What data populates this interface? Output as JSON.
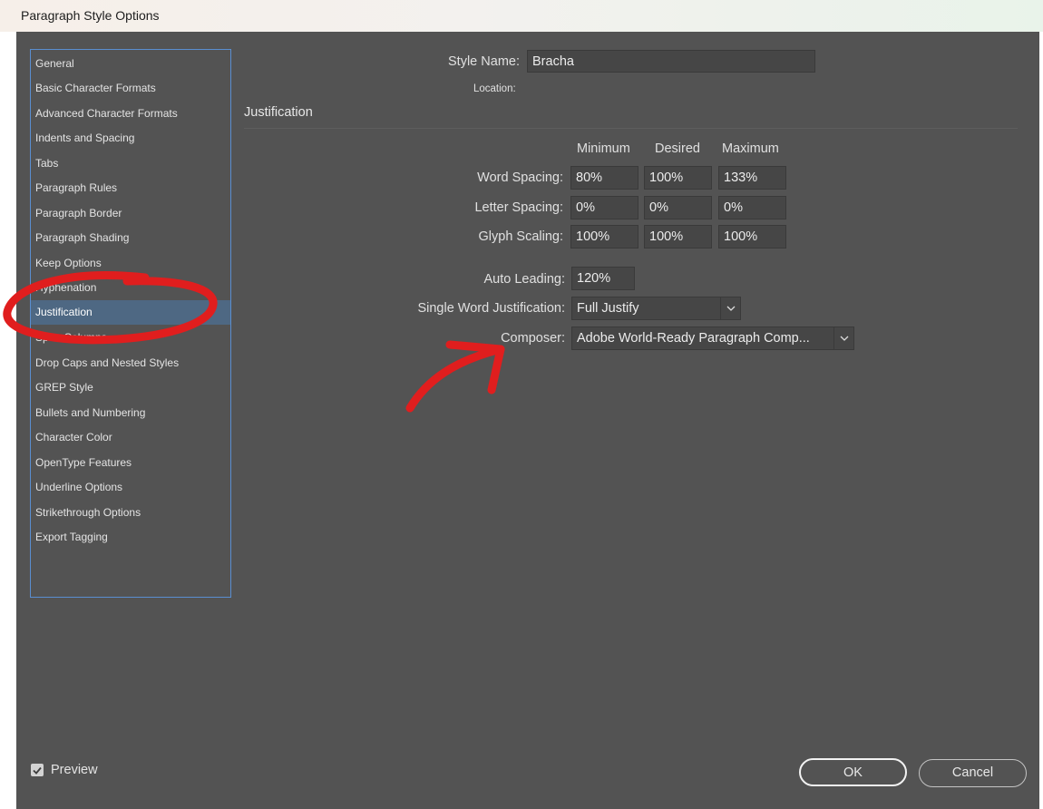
{
  "window": {
    "title": "Paragraph Style Options"
  },
  "sidebar": {
    "items": [
      {
        "label": "General"
      },
      {
        "label": "Basic Character Formats"
      },
      {
        "label": "Advanced Character Formats"
      },
      {
        "label": "Indents and Spacing"
      },
      {
        "label": "Tabs"
      },
      {
        "label": "Paragraph Rules"
      },
      {
        "label": "Paragraph Border"
      },
      {
        "label": "Paragraph Shading"
      },
      {
        "label": "Keep Options"
      },
      {
        "label": "Hyphenation"
      },
      {
        "label": "Justification"
      },
      {
        "label": "Span Columns"
      },
      {
        "label": "Drop Caps and Nested Styles"
      },
      {
        "label": "GREP Style"
      },
      {
        "label": "Bullets and Numbering"
      },
      {
        "label": "Character Color"
      },
      {
        "label": "OpenType Features"
      },
      {
        "label": "Underline Options"
      },
      {
        "label": "Strikethrough Options"
      },
      {
        "label": "Export Tagging"
      }
    ],
    "selected_index": 10
  },
  "header": {
    "style_name_label": "Style Name:",
    "style_name_value": "Bracha",
    "location_label": "Location:"
  },
  "section": {
    "title": "Justification"
  },
  "columns": {
    "minimum": "Minimum",
    "desired": "Desired",
    "maximum": "Maximum"
  },
  "rows": [
    {
      "label": "Word Spacing:",
      "minimum": "80%",
      "desired": "100%",
      "maximum": "133%"
    },
    {
      "label": "Letter Spacing:",
      "minimum": "0%",
      "desired": "0%",
      "maximum": "0%"
    },
    {
      "label": "Glyph Scaling:",
      "minimum": "100%",
      "desired": "100%",
      "maximum": "100%"
    }
  ],
  "auto_leading": {
    "label": "Auto Leading:",
    "value": "120%"
  },
  "single_word_justification": {
    "label": "Single Word Justification:",
    "value": "Full Justify"
  },
  "composer": {
    "label": "Composer:",
    "value": "Adobe World-Ready Paragraph Comp..."
  },
  "footer": {
    "preview_label": "Preview",
    "preview_checked": true,
    "ok_label": "OK",
    "cancel_label": "Cancel"
  },
  "colors": {
    "dialog_bg": "#535353",
    "selection": "#4e6883",
    "sidebar_border": "#5a8ed0",
    "annotation_red": "#e01e1e"
  },
  "icons": [
    "chevron-down-icon",
    "checkmark-icon"
  ]
}
